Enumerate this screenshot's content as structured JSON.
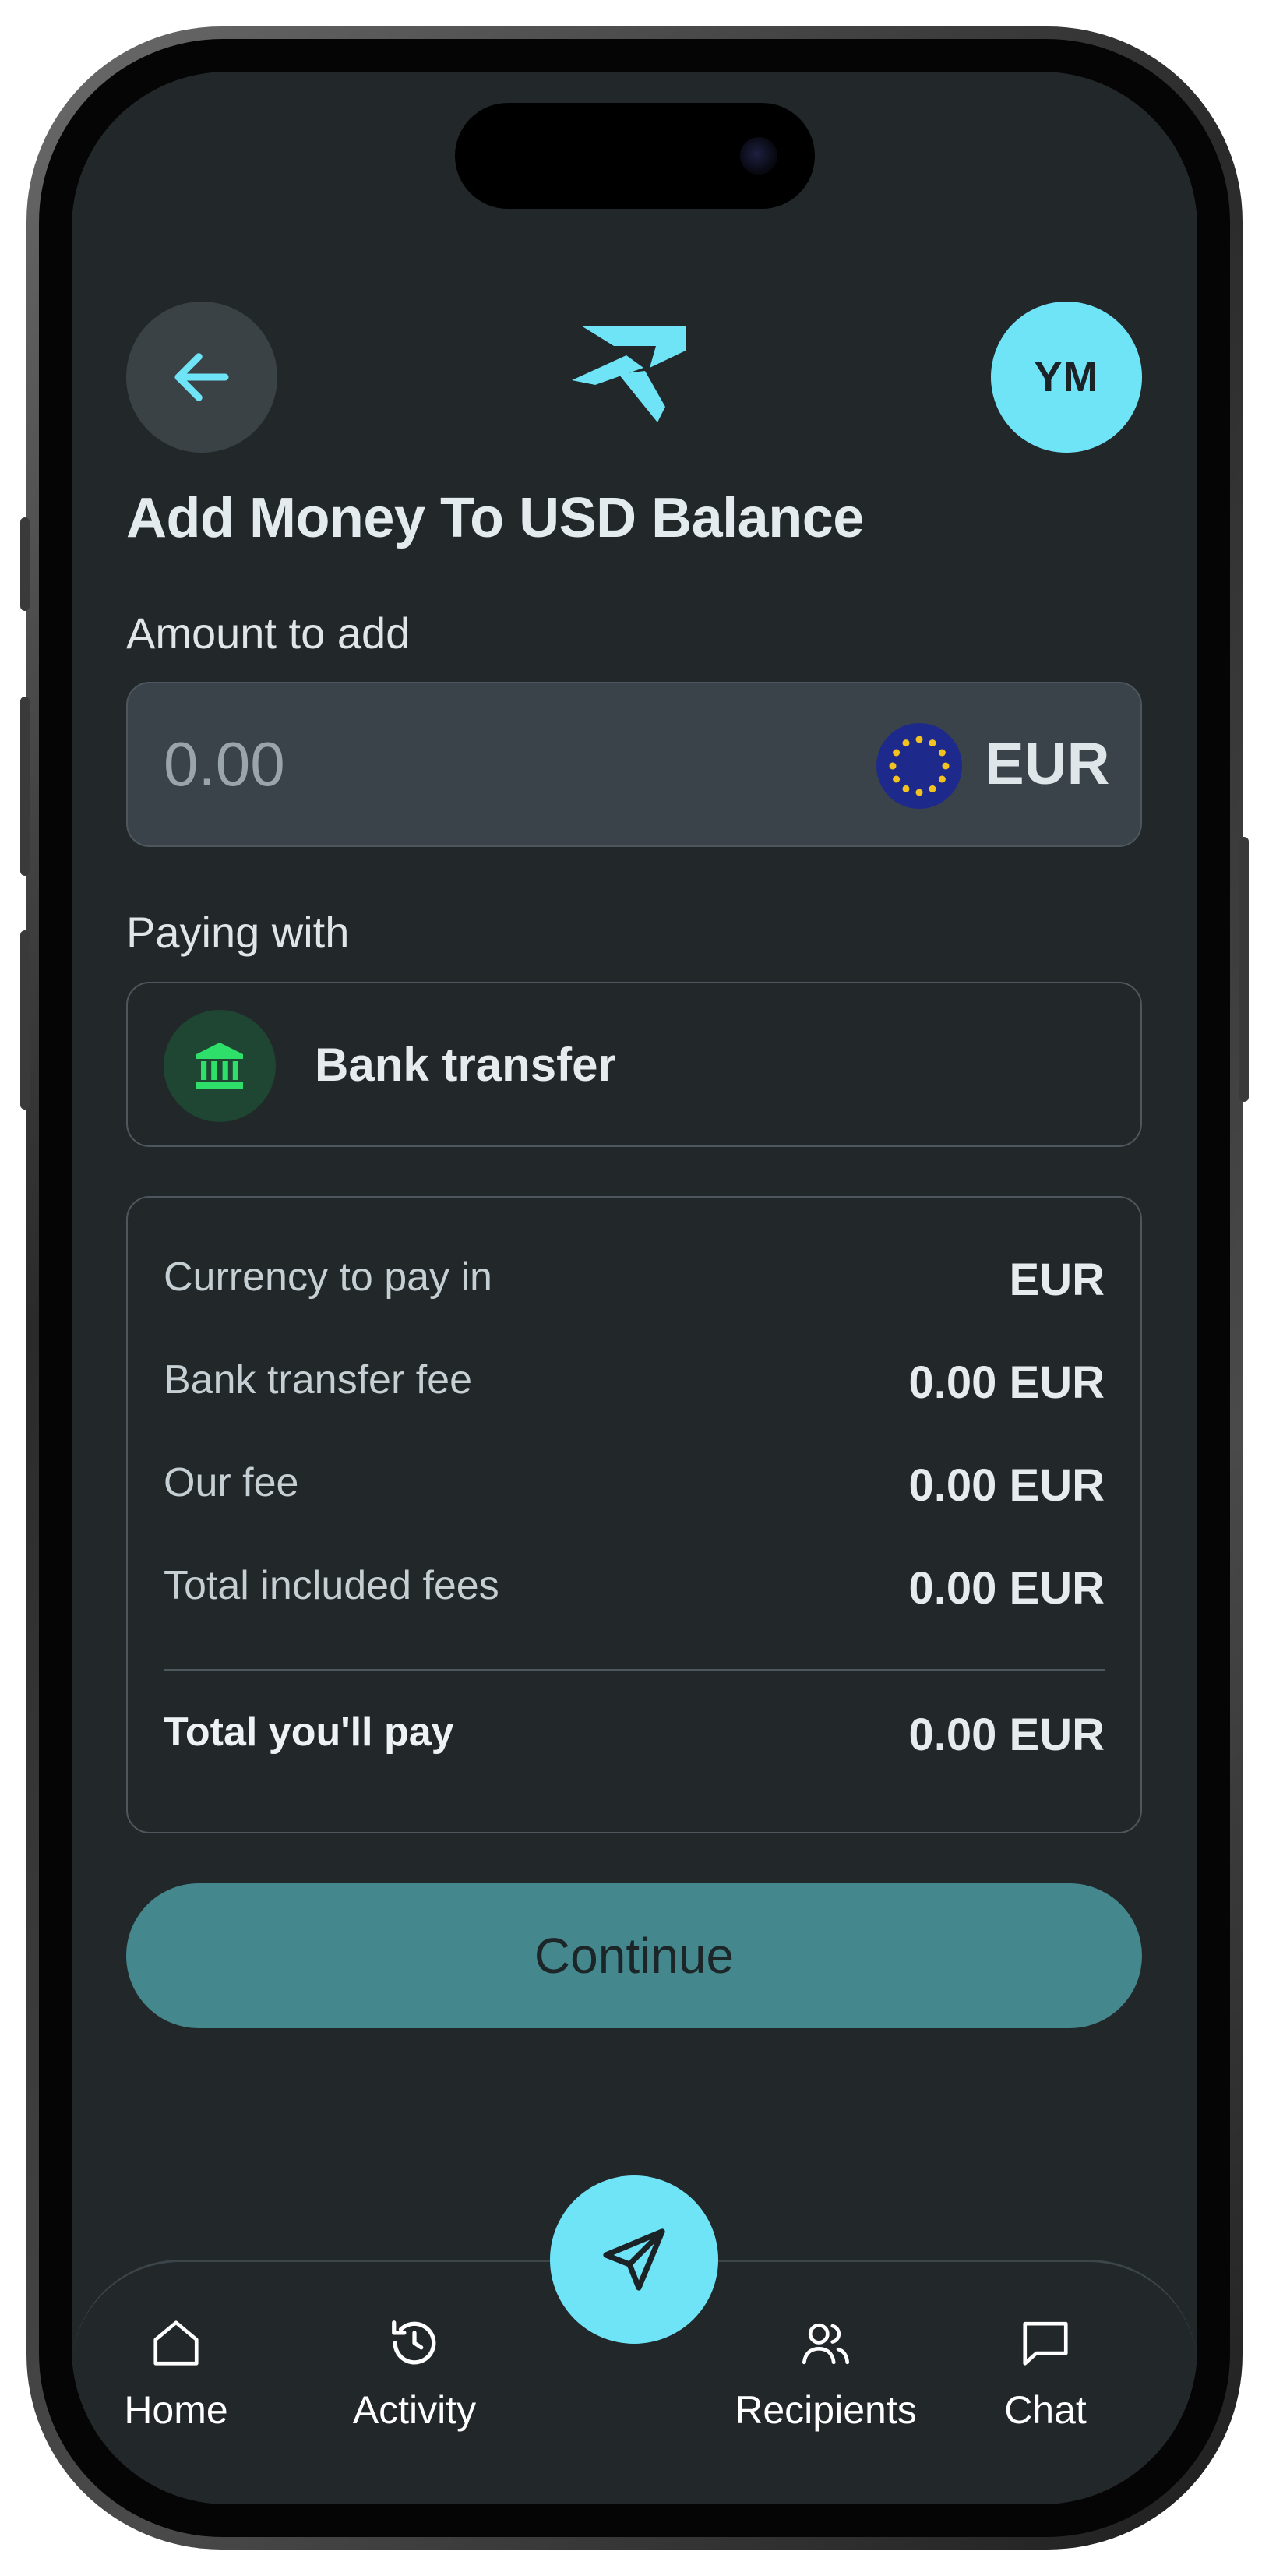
{
  "header": {
    "avatar_initials": "YM"
  },
  "page": {
    "title": "Add Money To USD Balance"
  },
  "amount": {
    "label": "Amount to add",
    "value": "0.00",
    "currency": "EUR",
    "currency_flag": "eu-flag-icon"
  },
  "payment": {
    "label": "Paying with",
    "method": "Bank transfer",
    "method_icon": "bank-icon"
  },
  "summary": {
    "rows": [
      {
        "label": "Currency to pay in",
        "value": "EUR"
      },
      {
        "label": "Bank transfer fee",
        "value": "0.00 EUR"
      },
      {
        "label": "Our fee",
        "value": "0.00 EUR"
      },
      {
        "label": "Total included fees",
        "value": "0.00 EUR"
      }
    ],
    "total": {
      "label": "Total you'll pay",
      "value": "0.00 EUR"
    }
  },
  "actions": {
    "continue_label": "Continue"
  },
  "nav": {
    "items": [
      {
        "label": "Home",
        "icon": "home-icon"
      },
      {
        "label": "Activity",
        "icon": "history-icon"
      },
      {
        "label": "Recipients",
        "icon": "users-icon"
      },
      {
        "label": "Chat",
        "icon": "chat-icon"
      }
    ],
    "send_icon": "send-icon"
  },
  "colors": {
    "accent": "#6fe4f7",
    "background": "#22272a",
    "button": "#44878d",
    "bank_icon": "#2ee06a"
  }
}
